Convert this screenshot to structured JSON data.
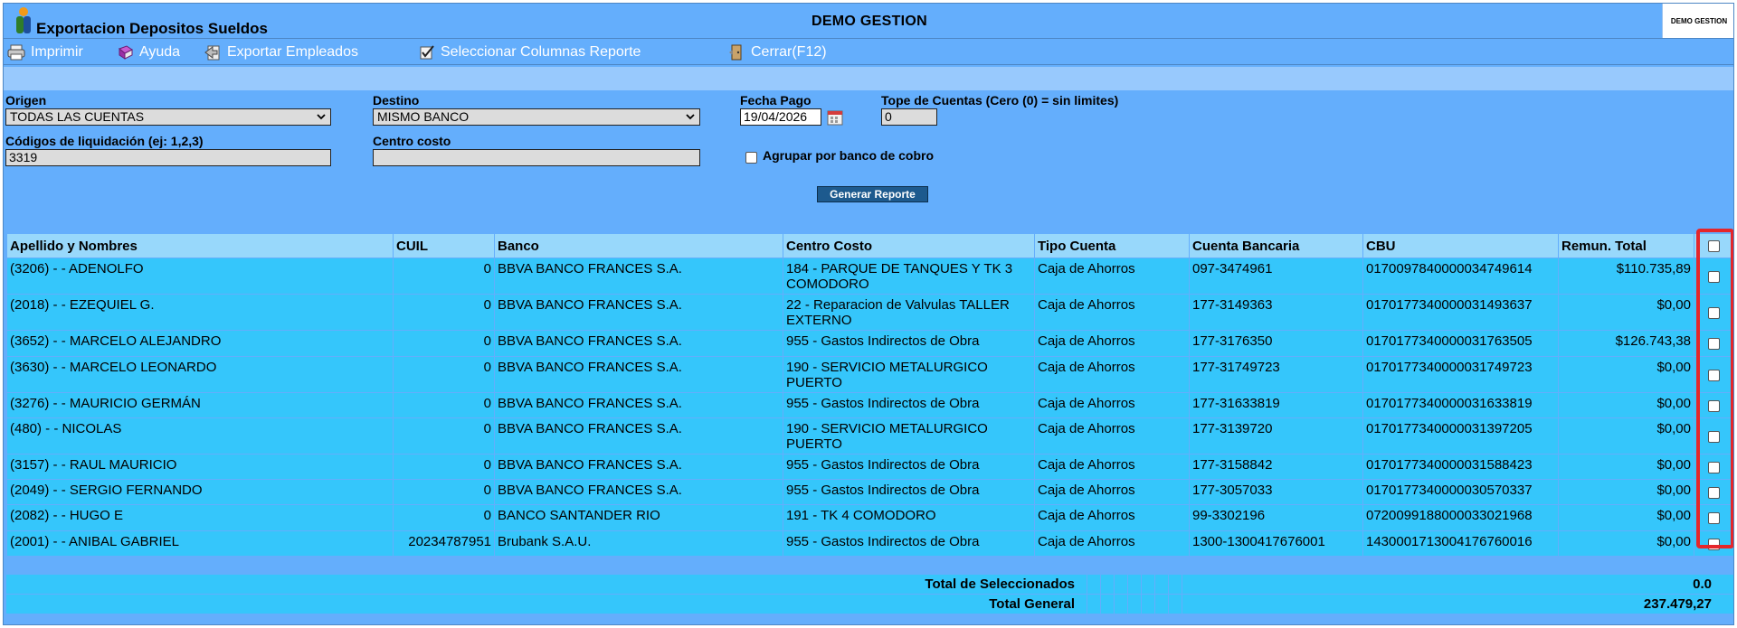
{
  "window": {
    "title": "Exportacion Depositos Sueldos",
    "company": "DEMO GESTION",
    "company_badge": "DEMO GESTION"
  },
  "toolbar": {
    "items": [
      {
        "label": "Imprimir",
        "icon": "printer-icon"
      },
      {
        "label": "Ayuda",
        "icon": "help-book-icon"
      },
      {
        "label": "Exportar Empleados",
        "icon": "export-icon"
      },
      {
        "label": "Seleccionar Columnas Reporte",
        "icon": "columns-check-icon"
      },
      {
        "label": "Cerrar(F12)",
        "icon": "close-door-icon"
      }
    ]
  },
  "form": {
    "origen": {
      "label": "Origen",
      "value": "TODAS LAS CUENTAS"
    },
    "destino": {
      "label": "Destino",
      "value": "MISMO BANCO"
    },
    "fecha_pago": {
      "label": "Fecha Pago",
      "value": "19/04/2026"
    },
    "tope": {
      "label": "Tope de Cuentas (Cero (0) = sin limites)",
      "value": "0"
    },
    "codigos": {
      "label": "Códigos de liquidación (ej: 1,2,3)",
      "value": "3319"
    },
    "centro_costo": {
      "label": "Centro costo",
      "value": ""
    },
    "agrupar": {
      "label": "Agrupar por banco de cobro",
      "checked": false
    },
    "generar_label": "Generar Reporte"
  },
  "table": {
    "headers": [
      "Apellido y Nombres",
      "CUIL",
      "Banco",
      "Centro Costo",
      "Tipo Cuenta",
      "Cuenta Bancaria",
      "CBU",
      "Remun. Total"
    ],
    "rows": [
      [
        "(3206) - - ADENOLFO",
        "0",
        "BBVA BANCO FRANCES S.A.",
        "184 - PARQUE DE TANQUES Y TK 3 COMODORO",
        "Caja de Ahorros",
        "097-3474961",
        "0170097840000034749614",
        "$110.735,89"
      ],
      [
        "(2018) - - EZEQUIEL G.",
        "0",
        "BBVA BANCO FRANCES S.A.",
        "22 - Reparacion de Valvulas TALLER EXTERNO",
        "Caja de Ahorros",
        "177-3149363",
        "0170177340000031493637",
        "$0,00"
      ],
      [
        "(3652) - - MARCELO ALEJANDRO",
        "0",
        "BBVA BANCO FRANCES S.A.",
        "955 - Gastos Indirectos de Obra",
        "Caja de Ahorros",
        "177-3176350",
        "0170177340000031763505",
        "$126.743,38"
      ],
      [
        "(3630) - - MARCELO LEONARDO",
        "0",
        "BBVA BANCO FRANCES S.A.",
        "190 - SERVICIO METALURGICO PUERTO",
        "Caja de Ahorros",
        "177-31749723",
        "0170177340000031749723",
        "$0,00"
      ],
      [
        "(3276) - - MAURICIO GERMÁN",
        "0",
        "BBVA BANCO FRANCES S.A.",
        "955 - Gastos Indirectos de Obra",
        "Caja de Ahorros",
        "177-31633819",
        "0170177340000031633819",
        "$0,00"
      ],
      [
        "(480) - - NICOLAS",
        "0",
        "BBVA BANCO FRANCES S.A.",
        "190 - SERVICIO METALURGICO PUERTO",
        "Caja de Ahorros",
        "177-3139720",
        "0170177340000031397205",
        "$0,00"
      ],
      [
        "(3157) - - RAUL MAURICIO",
        "0",
        "BBVA BANCO FRANCES S.A.",
        "955 - Gastos Indirectos de Obra",
        "Caja de Ahorros",
        "177-3158842",
        "0170177340000031588423",
        "$0,00"
      ],
      [
        "(2049) - - SERGIO FERNANDO",
        "0",
        "BBVA BANCO FRANCES S.A.",
        "955 - Gastos Indirectos de Obra",
        "Caja de Ahorros",
        "177-3057033",
        "0170177340000030570337",
        "$0,00"
      ],
      [
        "(2082) - - HUGO E",
        "0",
        "BANCO SANTANDER RIO",
        "191 - TK 4 COMODORO",
        "Caja de Ahorros",
        "99-3302196",
        "0720099188000033021968",
        "$0,00"
      ],
      [
        "(2001) - - ANIBAL GABRIEL",
        "20234787951",
        "Brubank S.A.U.",
        "955 - Gastos Indirectos de Obra",
        "Caja de Ahorros",
        "1300-1300417676001",
        "1430001713004176760016",
        "$0,00"
      ]
    ]
  },
  "totals": {
    "selected_label": "Total de Seleccionados",
    "selected_value": "0.0",
    "general_label": "Total General",
    "general_value": "237.479,27"
  },
  "colors": {
    "panel": "#64aefc",
    "row": "#35c6fb",
    "header": "#98d8fb",
    "highlight": "#e5262b"
  }
}
